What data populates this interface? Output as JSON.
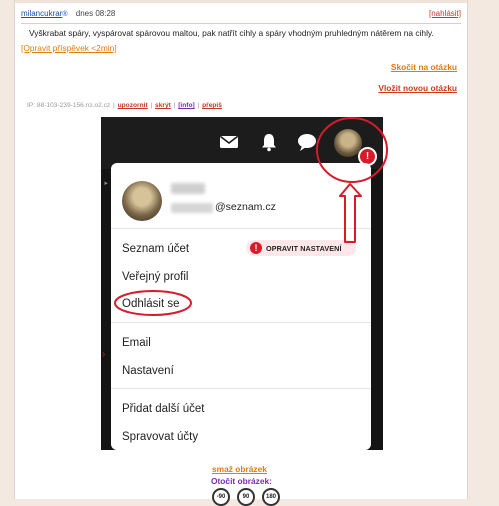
{
  "post": {
    "author": "milancukrar",
    "author_badge": "®",
    "date": "dnes 08:28",
    "report_label": "[nahlásit]",
    "text": "Vyškrabat spáry, vyspárovat spárovou maltou, pak natřít cihly a spáry vhodným pruhledným nátěrem na cihly.",
    "edit_link": "[Opravit příspěvek <2min]",
    "jump_link": "Skočit na otázku",
    "new_question_link": "Vložit novou otázku",
    "ip": "IP: 88-103-239-156.rci.o2.cz",
    "actions": [
      "upozornit",
      "skrýt",
      "[info]",
      "přepiš"
    ]
  },
  "screenshot": {
    "icons": [
      "mail-icon",
      "bell-icon",
      "chat-icon"
    ],
    "dropdown": {
      "email": "@seznam.cz",
      "fix_button": "OPRAVIT NASTAVENÍ",
      "items": [
        "Seznam účet",
        "Veřejný profil",
        "Odhlásit se",
        "Email",
        "Nastavení",
        "Přidat další účet",
        "Spravovat účty"
      ]
    },
    "warn_symbol": "!"
  },
  "annotation_color": "#d81b2a",
  "image_tools": {
    "delete_label": "smaž obrázek",
    "rotate_label": "Otočit obrázek:",
    "rotate_options": [
      "-90",
      "90",
      "180"
    ]
  }
}
